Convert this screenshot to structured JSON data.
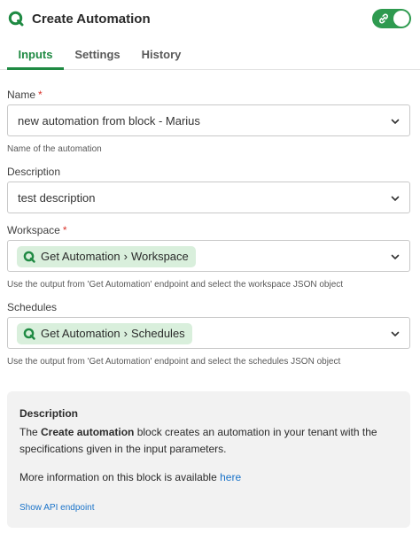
{
  "header": {
    "title": "Create Automation",
    "logo_icon": "qlik-q-icon",
    "toggle": {
      "state": "on",
      "icon": "link-icon",
      "color": "#2e9a4f"
    }
  },
  "tabs": [
    {
      "label": "Inputs",
      "active": true
    },
    {
      "label": "Settings",
      "active": false
    },
    {
      "label": "History",
      "active": false
    }
  ],
  "fields": {
    "name": {
      "label": "Name",
      "required_marker": "*",
      "value": "new automation from block - Marius",
      "help": "Name of the automation"
    },
    "description": {
      "label": "Description",
      "value": "test description"
    },
    "workspace": {
      "label": "Workspace",
      "required_marker": "*",
      "pill": {
        "source": "Get Automation",
        "separator": "›",
        "target": "Workspace"
      },
      "help": "Use the output from 'Get Automation' endpoint and select the workspace JSON object"
    },
    "schedules": {
      "label": "Schedules",
      "pill": {
        "source": "Get Automation",
        "separator": "›",
        "target": "Schedules"
      },
      "help": "Use the output from 'Get Automation' endpoint and select the schedules JSON object"
    }
  },
  "info_card": {
    "title": "Description",
    "text_before": "The ",
    "text_bold": "Create automation",
    "text_after": " block creates an automation in your tenant with the specifications given in the input parameters.",
    "more_text": "More information on this block is available ",
    "more_link": "here",
    "api_link": "Show API endpoint"
  },
  "colors": {
    "accent": "#1f8a43",
    "pill_bg": "#d9efdc",
    "link": "#1a73c9",
    "required": "#d9342b",
    "card_bg": "#f2f2f2"
  }
}
